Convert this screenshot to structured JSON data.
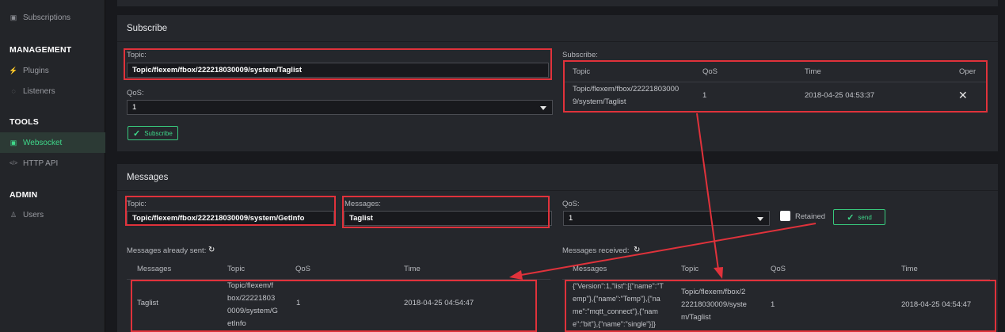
{
  "sidebar": {
    "top_item": {
      "label": "Subscriptions",
      "icon": "rss-icon"
    },
    "sections": [
      {
        "title": "MANAGEMENT",
        "items": [
          {
            "label": "Plugins",
            "icon": "plug-icon"
          },
          {
            "label": "Listeners",
            "icon": "listener-icon"
          }
        ]
      },
      {
        "title": "TOOLS",
        "items": [
          {
            "label": "Websocket",
            "icon": "websocket-icon",
            "active": true
          },
          {
            "label": "HTTP API",
            "icon": "code-icon"
          }
        ]
      },
      {
        "title": "ADMIN",
        "items": [
          {
            "label": "Users",
            "icon": "user-icon"
          }
        ]
      }
    ]
  },
  "subscribe": {
    "title": "Subscribe",
    "topic_label": "Topic:",
    "topic_value": "Topic/flexem/fbox/222218030009/system/Taglist",
    "qos_label": "QoS:",
    "qos_value": "1",
    "button_label": "Subscribe",
    "list_label": "Subscribe:",
    "columns": [
      "Topic",
      "QoS",
      "Time",
      "Oper"
    ],
    "rows": [
      {
        "topic_line1": "Topic/flexem/fbox/22221803000",
        "topic_line2": "9/system/Taglist",
        "qos": "1",
        "time": "2018-04-25 04:53:37",
        "oper": "✕"
      }
    ]
  },
  "messages": {
    "title": "Messages",
    "topic_label": "Topic:",
    "topic_value": "Topic/flexem/fbox/222218030009/system/GetInfo",
    "message_label": "Messages:",
    "message_value": "Taglist",
    "qos_label": "QoS:",
    "qos_value": "1",
    "retained_label": "Retained",
    "send_label": "send",
    "sent_label": "Messages already sent:",
    "received_label": "Messages received:",
    "sent_columns": [
      "Messages",
      "Topic",
      "QoS",
      "Time"
    ],
    "received_columns": [
      "Messages",
      "Topic",
      "QoS",
      "Time"
    ],
    "sent_rows": [
      {
        "message": "Taglist",
        "topic_lines": [
          "Topic/flexem/f",
          "box/22221803",
          "0009/system/G",
          "etInfo"
        ],
        "qos": "1",
        "time": "2018-04-25 04:54:47"
      }
    ],
    "received_rows": [
      {
        "message_lines": [
          "{\"Version\":1,\"list\":[{\"name\":\"T",
          "emp\"},{\"name\":\"Temp\"},{\"na",
          "me\":\"mqtt_connect\"},{\"nam",
          "e\":\"bit\"},{\"name\":\"single\"}]}"
        ],
        "topic_lines": [
          "Topic/flexem/fbox/2",
          "22218030009/syste",
          "m/Taglist"
        ],
        "qos": "1",
        "time": "2018-04-25 04:54:47"
      }
    ]
  },
  "colors": {
    "accent": "#3fd88a",
    "annotation": "#e0323b",
    "background": "#18191d",
    "panel": "#25272c"
  }
}
